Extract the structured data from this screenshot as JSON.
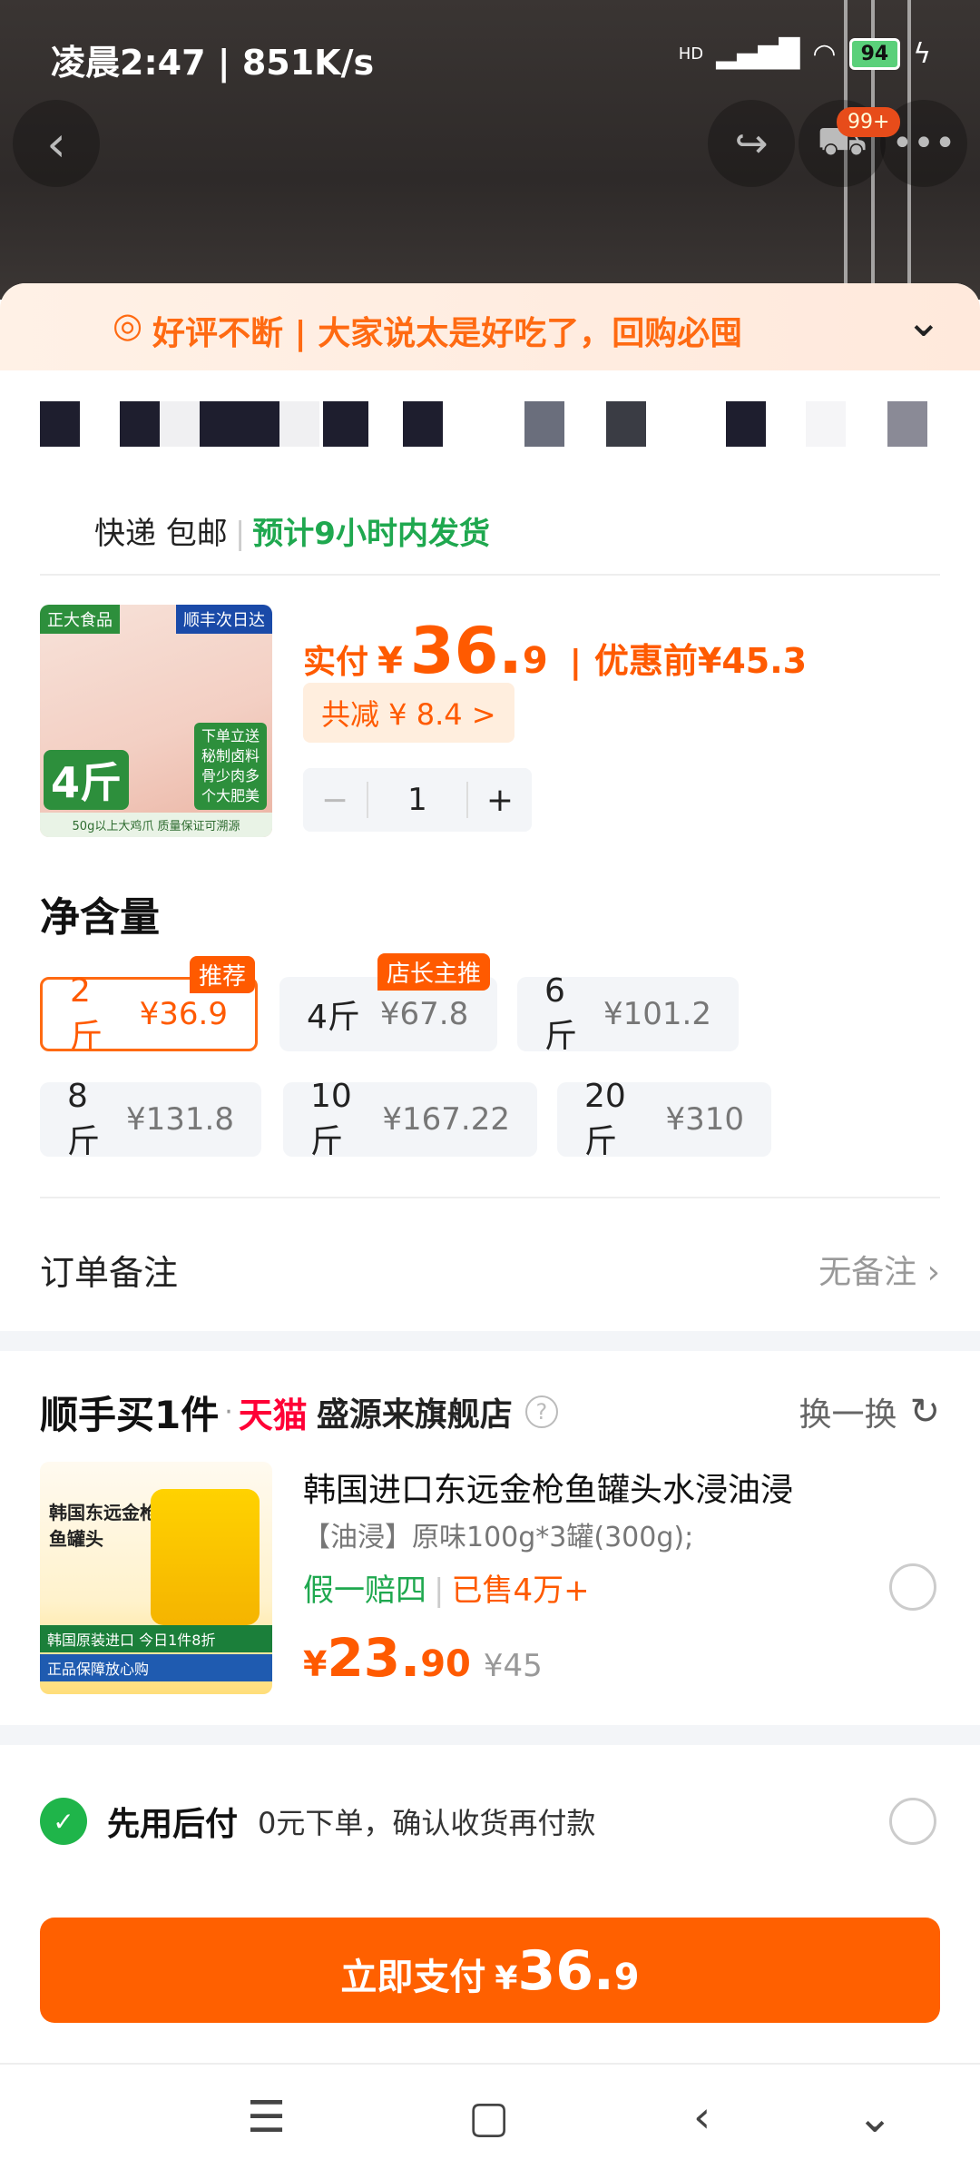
{
  "status_bar": {
    "time": "凌晨2:47 | 851K/s",
    "network": "HD",
    "battery": "94"
  },
  "nav": {
    "cart_badge": "99+"
  },
  "banner": {
    "text": "好评不断 | 大家说太是好吃了，回购必囤"
  },
  "shipping": {
    "method": "快递 包邮",
    "eta": "预计9小时内发货"
  },
  "product": {
    "image_labels": {
      "brand": "正大食品",
      "delivery": "顺丰次日达",
      "weight": "4斤",
      "side": "下单立送 秘制卤料 骨少肉多 个大肥美",
      "bottom": "50g以上大鸡爪 质量保证可溯源"
    },
    "price_label": "实付",
    "currency": "¥",
    "price_int": "36.",
    "price_dec": "9",
    "before_label": "优惠前",
    "before_price": "¥45.3",
    "discount": "共减 ¥ 8.4 >",
    "quantity": "1"
  },
  "net_weight": {
    "title": "净含量",
    "options": [
      {
        "size": "2斤",
        "price": "¥36.9",
        "tag": "推荐",
        "selected": true
      },
      {
        "size": "4斤",
        "price": "¥67.8",
        "tag": "店长主推",
        "selected": false
      },
      {
        "size": "6斤",
        "price": "¥101.2",
        "tag": "",
        "selected": false
      },
      {
        "size": "8斤",
        "price": "¥131.8",
        "tag": "",
        "selected": false
      },
      {
        "size": "10斤",
        "price": "¥167.22",
        "tag": "",
        "selected": false
      },
      {
        "size": "20斤",
        "price": "¥310",
        "tag": "",
        "selected": false
      }
    ]
  },
  "remark": {
    "label": "订单备注",
    "value": "无备注"
  },
  "upsell": {
    "heading": "顺手买1件",
    "platform": "天猫",
    "shop": "盛源来旗舰店",
    "swap": "换一换",
    "image_labels": {
      "title": "韩国东远金枪鱼罐头",
      "strip": "韩国原装进口 今日1件8折",
      "strip2": "正品保障放心购"
    },
    "title": "韩国进口东远金枪鱼罐头水浸油浸",
    "spec": "【油浸】原味100g*3罐(300g);",
    "guarantee": "假一赔四",
    "sold": "已售4万+",
    "currency": "¥",
    "price_int": "23.",
    "price_dec": "90",
    "orig_price": "¥45"
  },
  "payment": {
    "later_title": "先用后付",
    "later_desc": "0元下单，确认收货再付款"
  },
  "pay_button": {
    "label": "立即支付",
    "currency": "¥",
    "price_int": "36.",
    "price_dec": "9"
  },
  "colors": {
    "accent": "#ff6000",
    "green": "#1fa84f",
    "tmall_red": "#ff0036"
  }
}
